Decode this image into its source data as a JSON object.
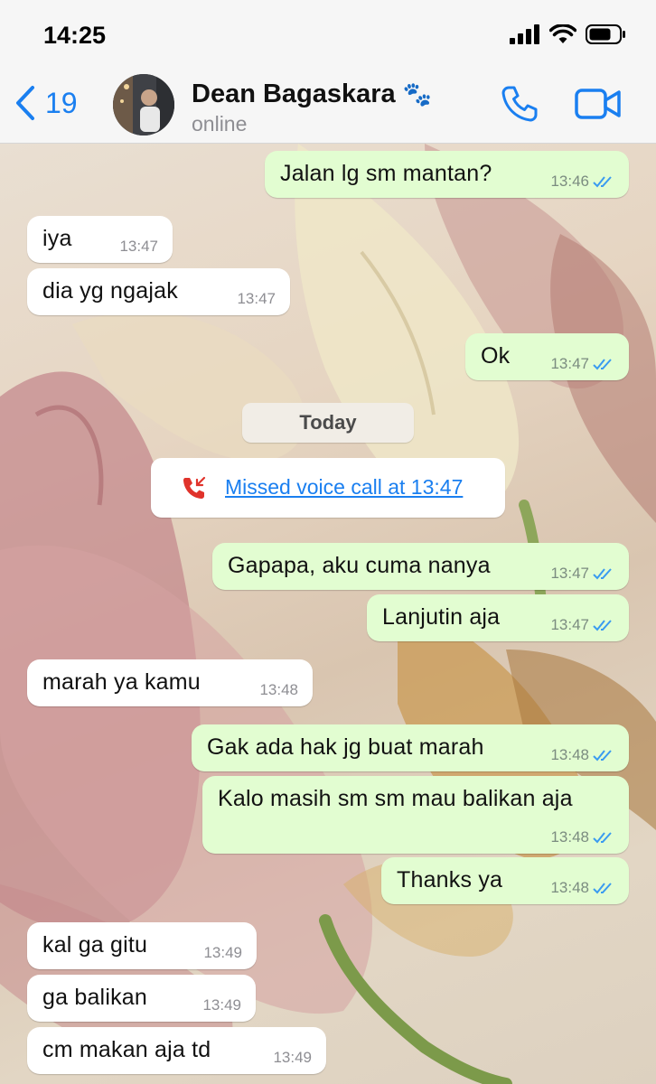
{
  "status_bar": {
    "time": "14:25"
  },
  "header": {
    "back_count": "19",
    "contact_name": "Dean Bagaskara",
    "contact_emoji": "🐾",
    "contact_status": "online",
    "accent_color": "#1a7ff0"
  },
  "chat": {
    "day_label": "Today",
    "missed_call": "Missed voice call at 13:47",
    "messages": [
      {
        "dir": "out",
        "text": "Jalan lg sm mantan?",
        "time": "13:46",
        "read": true
      },
      {
        "dir": "in",
        "text": "iya",
        "time": "13:47"
      },
      {
        "dir": "in",
        "text": "dia yg ngajak",
        "time": "13:47"
      },
      {
        "dir": "out",
        "text": "Ok",
        "time": "13:47",
        "read": true
      },
      {
        "dir": "out",
        "text": "Gapapa, aku cuma nanya",
        "time": "13:47",
        "read": true
      },
      {
        "dir": "out",
        "text": "Lanjutin aja",
        "time": "13:47",
        "read": true
      },
      {
        "dir": "in",
        "text": "marah ya kamu",
        "time": "13:48"
      },
      {
        "dir": "out",
        "text": "Gak ada hak jg buat marah",
        "time": "13:48",
        "read": true
      },
      {
        "dir": "out",
        "text": "Kalo masih sm sm mau balikan aja",
        "time": "13:48",
        "read": true
      },
      {
        "dir": "out",
        "text": "Thanks ya",
        "time": "13:48",
        "read": true
      },
      {
        "dir": "in",
        "text": "kal ga gitu",
        "time": "13:49"
      },
      {
        "dir": "in",
        "text": "ga balikan",
        "time": "13:49"
      },
      {
        "dir": "in",
        "text": "cm makan aja td",
        "time": "13:49"
      }
    ]
  }
}
